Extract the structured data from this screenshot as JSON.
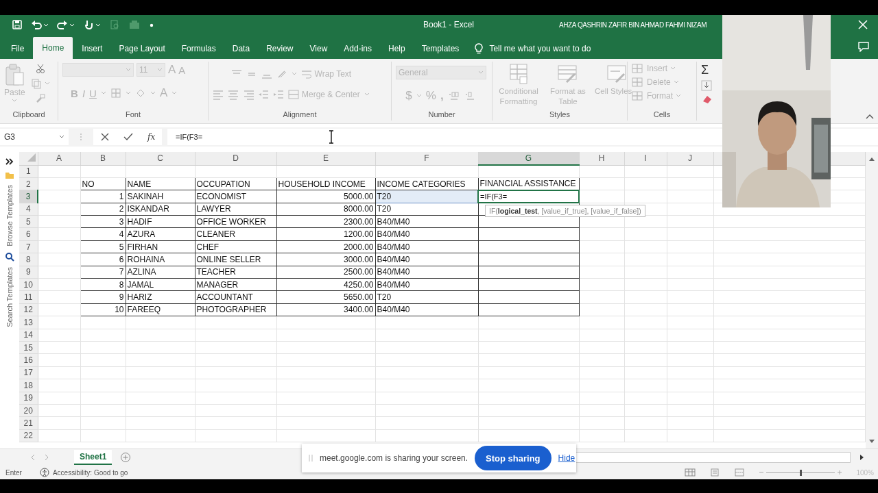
{
  "title_bar": {
    "document": "Book1  -  Excel",
    "user": "AHZA QASHRIN ZAFIR BIN AHMAD FAHMI NIZAM"
  },
  "tabs": [
    {
      "label": "File",
      "selected": false
    },
    {
      "label": "Home",
      "selected": true
    },
    {
      "label": "Insert",
      "selected": false
    },
    {
      "label": "Page Layout",
      "selected": false
    },
    {
      "label": "Formulas",
      "selected": false
    },
    {
      "label": "Data",
      "selected": false
    },
    {
      "label": "Review",
      "selected": false
    },
    {
      "label": "View",
      "selected": false
    },
    {
      "label": "Add-ins",
      "selected": false
    },
    {
      "label": "Help",
      "selected": false
    },
    {
      "label": "Templates",
      "selected": false
    }
  ],
  "tell_me": "Tell me what you want to do",
  "ribbon": {
    "disabled": true,
    "groups": [
      {
        "kind": "clipboard",
        "label": "Clipboard",
        "paste": "Paste"
      },
      {
        "kind": "font",
        "label": "Font",
        "size": "11",
        "grow": "A",
        "shrink": "A",
        "bold": "B",
        "italic": "I",
        "underline": "U",
        "font_color_glyph": "A"
      },
      {
        "kind": "alignment",
        "label": "Alignment",
        "wrap": "Wrap Text",
        "merge": "Merge & Center"
      },
      {
        "kind": "number",
        "label": "Number",
        "format": "General",
        "currency": "$",
        "percent": "%",
        "comma": ","
      },
      {
        "kind": "styles",
        "label": "Styles",
        "buttons": [
          "Conditional Formatting",
          "Format as Table",
          "Cell Styles"
        ]
      },
      {
        "kind": "cells",
        "label": "Cells",
        "buttons": [
          "Insert",
          "Delete",
          "Format"
        ]
      },
      {
        "kind": "editing",
        "sum": "Σ"
      }
    ]
  },
  "formula_bar": {
    "name_box": "G3",
    "fx": "fx",
    "formula": "=IF(F3="
  },
  "side_panel": {
    "browse": "Browse Templates",
    "search": "Search Templates"
  },
  "sheet": {
    "columns": [
      {
        "label": "A",
        "selected": false
      },
      {
        "label": "B",
        "selected": false
      },
      {
        "label": "C",
        "selected": false
      },
      {
        "label": "D",
        "selected": false
      },
      {
        "label": "E",
        "selected": false
      },
      {
        "label": "F",
        "selected": false
      },
      {
        "label": "G",
        "selected": true
      },
      {
        "label": "H",
        "selected": false
      },
      {
        "label": "I",
        "selected": false
      },
      {
        "label": "J",
        "selected": false
      }
    ],
    "rows": [
      {
        "label": "1",
        "selected": false
      },
      {
        "label": "2",
        "selected": false,
        "kind": "header",
        "cells": {
          "no": "NO",
          "name": "NAME",
          "occupation": "OCCUPATION",
          "household_income": "HOUSEHOLD INCOME",
          "income_category": "INCOME CATEGORIES",
          "financial_assistance": "FINANCIAL ASSISTANCE"
        }
      },
      {
        "label": "3",
        "selected": true,
        "kind": "record",
        "cells": {
          "no": "1",
          "name": "SAKINAH",
          "occupation": "ECONOMIST",
          "household_income": "5000.00",
          "income_category": {
            "text": "T20",
            "referenced": true
          },
          "financial_assistance": {
            "text": "=IF(F3=",
            "editing": true
          }
        }
      },
      {
        "label": "4",
        "selected": false,
        "kind": "record",
        "cells": {
          "no": "2",
          "name": "ISKANDAR",
          "occupation": "LAWYER",
          "household_income": "8000.00",
          "income_category": "T20"
        }
      },
      {
        "label": "5",
        "selected": false,
        "kind": "record",
        "cells": {
          "no": "3",
          "name": "HADIF",
          "occupation": "OFFICE WORKER",
          "household_income": "2300.00",
          "income_category": "B40/M40"
        }
      },
      {
        "label": "6",
        "selected": false,
        "kind": "record",
        "cells": {
          "no": "4",
          "name": "AZURA",
          "occupation": "CLEANER",
          "household_income": "1200.00",
          "income_category": "B40/M40"
        }
      },
      {
        "label": "7",
        "selected": false,
        "kind": "record",
        "cells": {
          "no": "5",
          "name": "FIRHAN",
          "occupation": "CHEF",
          "household_income": "2000.00",
          "income_category": "B40/M40"
        }
      },
      {
        "label": "8",
        "selected": false,
        "kind": "record",
        "cells": {
          "no": "6",
          "name": "ROHAINA",
          "occupation": "ONLINE SELLER",
          "household_income": "3000.00",
          "income_category": "B40/M40"
        }
      },
      {
        "label": "9",
        "selected": false,
        "kind": "record",
        "cells": {
          "no": "7",
          "name": "AZLINA",
          "occupation": "TEACHER",
          "household_income": "2500.00",
          "income_category": "B40/M40"
        }
      },
      {
        "label": "10",
        "selected": false,
        "kind": "record",
        "cells": {
          "no": "8",
          "name": "JAMAL",
          "occupation": "MANAGER",
          "household_income": "4250.00",
          "income_category": "B40/M40"
        }
      },
      {
        "label": "11",
        "selected": false,
        "kind": "record",
        "cells": {
          "no": "9",
          "name": "HARIZ",
          "occupation": "ACCOUNTANT",
          "household_income": "5650.00",
          "income_category": "T20"
        }
      },
      {
        "label": "12",
        "selected": false,
        "kind": "record",
        "cells": {
          "no": "10",
          "name": "FAREEQ",
          "occupation": "PHOTOGRAPHER",
          "household_income": "3400.00",
          "income_category": "B40/M40"
        }
      },
      {
        "label": "13",
        "selected": false
      },
      {
        "label": "14",
        "selected": false
      },
      {
        "label": "15",
        "selected": false
      },
      {
        "label": "16",
        "selected": false
      },
      {
        "label": "17",
        "selected": false
      },
      {
        "label": "18",
        "selected": false
      },
      {
        "label": "19",
        "selected": false
      },
      {
        "label": "20",
        "selected": false
      },
      {
        "label": "21",
        "selected": false
      },
      {
        "label": "22",
        "selected": false
      }
    ]
  },
  "tooltip": "IF(**logical_test**, [value_if_true], [value_if_false])",
  "sheet_tabs": [
    {
      "label": "Sheet1",
      "selected": true
    }
  ],
  "status_bar": {
    "mode": "Enter",
    "accessibility": "Accessibility: Good to go",
    "zoom_slider": {
      "level": 0.5
    },
    "zoom": "100%"
  },
  "share_bar": {
    "message": "meet.google.com is sharing your screen.",
    "stop": "Stop sharing",
    "hide": "Hide"
  }
}
